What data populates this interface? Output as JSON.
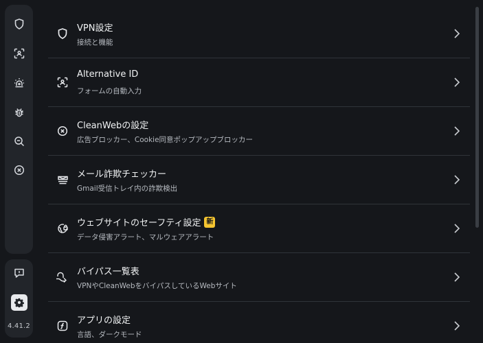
{
  "sidebar": {
    "icons": [
      "shield-icon",
      "face-scan-icon",
      "alarm-icon",
      "bug-icon",
      "search-minus-icon",
      "close-circle-icon"
    ],
    "bottom_icons": [
      "feedback-icon",
      "gear-icon"
    ],
    "version": "4.41.2"
  },
  "settings": {
    "items": [
      {
        "icon": "shield-icon",
        "title": "VPN設定",
        "subtitle": "接続と機能",
        "badge": ""
      },
      {
        "icon": "face-id-icon",
        "title": "Alternative ID",
        "subtitle": "フォームの自動入力",
        "badge": ""
      },
      {
        "icon": "cleanweb-icon",
        "title": "CleanWebの設定",
        "subtitle": "広告ブロッカー、Cookie同意ポップアップブロッカー",
        "badge": ""
      },
      {
        "icon": "mail-check-icon",
        "title": "メール詐欺チェッカー",
        "subtitle": "Gmail受信トレイ内の詐欺検出",
        "badge": ""
      },
      {
        "icon": "globe-lock-icon",
        "title": "ウェブサイトのセーフティ設定",
        "subtitle": "データ侵害アラート、マルウェアアラート",
        "badge": "新"
      },
      {
        "icon": "bypass-icon",
        "title": "バイパス一覧表",
        "subtitle": "VPNやCleanWebをバイパスしているWebサイト",
        "badge": ""
      },
      {
        "icon": "app-settings-icon",
        "title": "アプリの設定",
        "subtitle": "言語、ダークモード",
        "badge": ""
      }
    ]
  }
}
